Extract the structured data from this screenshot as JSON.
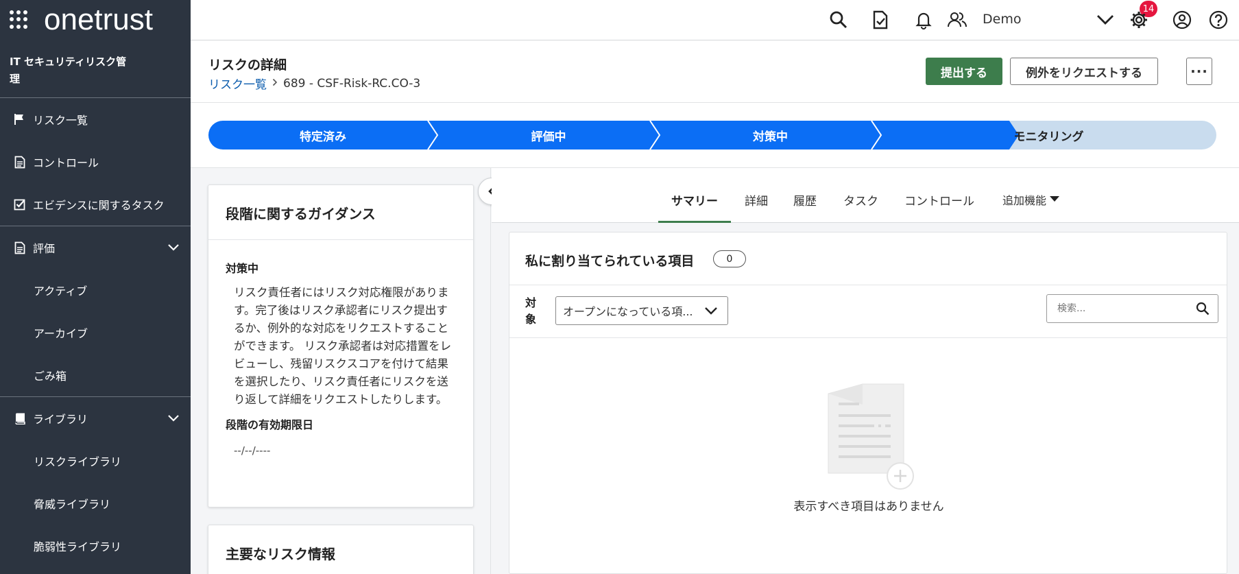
{
  "app": {
    "logo_text": "onetrust",
    "module_title": "IT セキュリティリスク管理"
  },
  "sidebar": {
    "items": [
      {
        "label": "リスク一覧",
        "icon": "flag-icon"
      },
      {
        "label": "コントロール",
        "icon": "document-icon"
      },
      {
        "label": "エビデンスに関するタスク",
        "icon": "checkbox-icon"
      },
      {
        "label": "評価",
        "icon": "document-icon",
        "expandable": true
      },
      {
        "label": "アクティブ"
      },
      {
        "label": "アーカイブ"
      },
      {
        "label": "ごみ箱"
      },
      {
        "label": "ライブラリ",
        "icon": "book-icon",
        "expandable": true
      },
      {
        "label": "リスクライブラリ"
      },
      {
        "label": "脅威ライブラリ"
      },
      {
        "label": "脆弱性ライブラリ"
      }
    ]
  },
  "topbar": {
    "notification_count": "14",
    "user_name": "Demo"
  },
  "page": {
    "title": "リスクの詳細",
    "breadcrumb_root": "リスク一覧",
    "breadcrumb_current": "689 - CSF-Risk-RC.CO-3",
    "submit_label": "提出する",
    "exception_label": "例外をリクエストする",
    "more_label": "···"
  },
  "stages": [
    {
      "label": "特定済み",
      "state": "complete"
    },
    {
      "label": "評価中",
      "state": "complete"
    },
    {
      "label": "対策中",
      "state": "current"
    },
    {
      "label": "モニタリング",
      "state": "upcoming"
    }
  ],
  "colors": {
    "stage_active": "#0b6ef5",
    "stage_upcoming": "#c9dcee",
    "primary_button": "#3d7d4c",
    "sidebar_bg": "#2c3440",
    "badge": "#e5163f"
  },
  "guidance": {
    "title": "段階に関するガイダンス",
    "stage_label": "対策中",
    "text": "リスク責任者にはリスク対応権限があります。完了後はリスク承認者にリスク提出するか、例外的な対応をリクエストすることができます。 リスク承認者は対応措置をレビューし、残留リスクスコアを付けて結果を選択したり、リスク責任者にリスクを送り返して詳細をリクエストしたりします。",
    "due_label": "段階の有効期限日",
    "due_value": "--/--/----"
  },
  "key_info": {
    "title": "主要なリスク情報"
  },
  "tabs": [
    {
      "label": "サマリー",
      "active": true
    },
    {
      "label": "詳細"
    },
    {
      "label": "履歴"
    },
    {
      "label": "タスク"
    },
    {
      "label": "コントロール"
    },
    {
      "label": "追加機能"
    }
  ],
  "assigned": {
    "title": "私に割り当てられている項目",
    "count": "0",
    "filter_label": "対象",
    "filter_value": "オープンになっている項...",
    "search_placeholder": "検索...",
    "empty_text": "表示すべき項目はありません"
  }
}
